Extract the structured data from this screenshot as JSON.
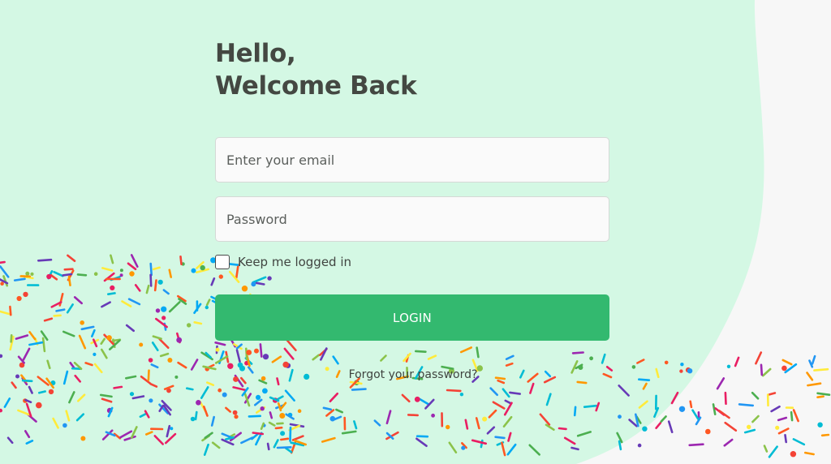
{
  "login": {
    "greeting_line_1": "Hello,",
    "greeting_line_2": "Welcome Back",
    "email_placeholder": "Enter your email",
    "password_placeholder": "Password",
    "remember_label": "Keep me logged in",
    "login_label": "LOGIN",
    "forgot_password": "Forgot your password?"
  },
  "decor": {
    "background_shape": "mint-blob",
    "confetti": "sprinkles"
  },
  "colors": {
    "page_background": "#f7f7f7",
    "mint_panel": "#d4f8e4",
    "primary_button": "#33b96f",
    "heading_text": "#444842",
    "input_background": "#fafafa",
    "input_border": "#d5d9d6"
  }
}
